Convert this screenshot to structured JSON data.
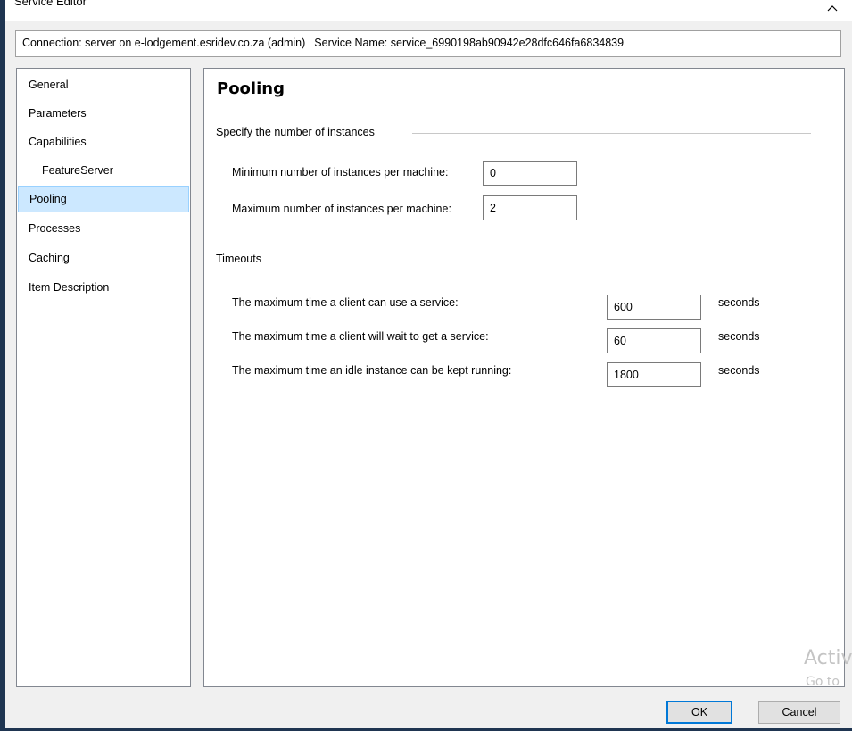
{
  "window": {
    "title": "Service Editor",
    "connection_text": "Connection: server on e-lodgement.esridev.co.za (admin)",
    "service_name_text": "Service Name: service_6990198ab90942e28dfc646fa6834839"
  },
  "nav": {
    "items": [
      {
        "label": "General"
      },
      {
        "label": "Parameters"
      },
      {
        "label": "Capabilities"
      },
      {
        "label": "FeatureServer"
      },
      {
        "label": "Pooling"
      },
      {
        "label": "Processes"
      },
      {
        "label": "Caching"
      },
      {
        "label": "Item Description"
      }
    ],
    "selected": "Pooling"
  },
  "pooling": {
    "title": "Pooling",
    "instances": {
      "group_label": "Specify the number of instances",
      "min_label": "Minimum number of instances per machine:",
      "min_value": "0",
      "max_label": "Maximum number of instances per machine:",
      "max_value": "2"
    },
    "timeouts": {
      "group_label": "Timeouts",
      "use_label": "The maximum time a client can use a service:",
      "use_value": "600",
      "wait_label": "The maximum time a client will wait to get a service:",
      "wait_value": "60",
      "idle_label": "The maximum time an idle instance can be kept running:",
      "idle_value": "1800",
      "unit": "seconds"
    }
  },
  "watermark": {
    "line1": "Activ",
    "line2": "Go to"
  },
  "buttons": {
    "ok": "OK",
    "cancel": "Cancel"
  }
}
